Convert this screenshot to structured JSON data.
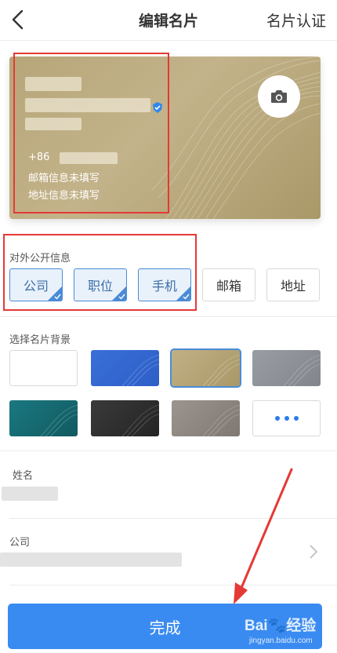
{
  "header": {
    "title": "编辑名片",
    "action_label": "名片认证"
  },
  "card": {
    "phone_prefix": "+86",
    "email_placeholder": "邮箱信息未填写",
    "address_placeholder": "地址信息未填写",
    "verified": true
  },
  "public_info": {
    "label": "对外公开信息",
    "tags": [
      {
        "label": "公司",
        "selected": true
      },
      {
        "label": "职位",
        "selected": true
      },
      {
        "label": "手机",
        "selected": true
      },
      {
        "label": "邮箱",
        "selected": false
      },
      {
        "label": "地址",
        "selected": false
      }
    ]
  },
  "backgrounds": {
    "label": "选择名片背景",
    "swatches": [
      {
        "name": "white",
        "color": "#ffffff",
        "selected": false
      },
      {
        "name": "blue",
        "color": "#3767d1",
        "selected": false
      },
      {
        "name": "gold",
        "color": "#b8a77a",
        "selected": true
      },
      {
        "name": "gray",
        "color": "#8e9198",
        "selected": false
      },
      {
        "name": "teal",
        "color": "#166b72",
        "selected": false
      },
      {
        "name": "black",
        "color": "#2e2e2e",
        "selected": false
      },
      {
        "name": "warm-gray",
        "color": "#8f8680",
        "selected": false
      }
    ],
    "more_icon": "more-dots-icon"
  },
  "form": {
    "name_label": "姓名",
    "company_label": "公司"
  },
  "footer": {
    "done_label": "完成"
  },
  "watermark": {
    "brand": "Bai",
    "brand_tail": "经验",
    "url": "jingyan.baidu.com"
  },
  "colors": {
    "accent": "#3a8bf1",
    "highlight_box": "#e53935",
    "selected_tag_border": "#4a8bd6"
  }
}
